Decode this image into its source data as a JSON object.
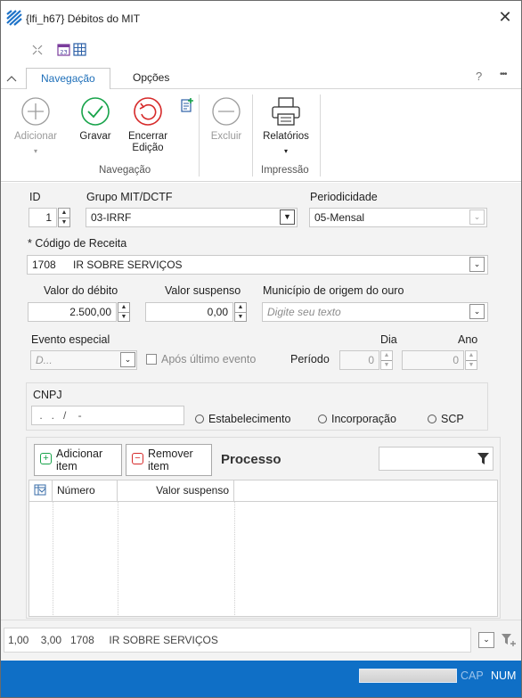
{
  "window": {
    "title": "{lfi_h67} Débitos do MIT"
  },
  "ribbon_tabs": [
    "Navegação",
    "Opções"
  ],
  "ribbon": {
    "help": "?",
    "more": "•••",
    "buttons": {
      "adicionar": "Adicionar",
      "gravar": "Gravar",
      "encerrar": "Encerrar",
      "edicao": "Edição",
      "excluir": "Excluir",
      "relatorios": "Relatórios"
    },
    "groups": {
      "navegacao": "Navegação",
      "impressao": "Impressão"
    }
  },
  "form": {
    "id_label": "ID",
    "id_value": "1",
    "grupo_label": "Grupo MIT/DCTF",
    "grupo_value": "03-IRRF",
    "periodicidade_label": "Periodicidade",
    "periodicidade_value": "05-Mensal",
    "codigo_label": "* Código de Receita",
    "codigo_num": "1708",
    "codigo_desc": "IR SOBRE SERVIÇOS",
    "valor_debito_label": "Valor do débito",
    "valor_debito_value": "2.500,00",
    "valor_suspenso_label": "Valor suspenso",
    "valor_suspenso_value": "0,00",
    "municipio_label": "Município de origem do ouro",
    "municipio_placeholder": "Digite seu texto",
    "evento_label": "Evento especial",
    "evento_value": "D...",
    "apos_label": "Após último evento",
    "periodo_label": "Período",
    "dia_label": "Dia",
    "dia_value": "0",
    "ano_label": "Ano",
    "ano_value": "0",
    "cnpj_label": "CNPJ",
    "cnpj_value": " .   .   /    -",
    "radios": [
      "Estabelecimento",
      "Incorporação",
      "SCP"
    ]
  },
  "processo": {
    "add_line1": "Adicionar",
    "add_line2": "item",
    "remove_line1": "Remover",
    "remove_line2": "item",
    "title": "Processo",
    "columns": [
      "Número",
      "Valor suspenso"
    ]
  },
  "summary": "1,00    3,00   1708     IR SOBRE SERVIÇOS",
  "status": {
    "cap": "CAP",
    "num": "NUM"
  }
}
